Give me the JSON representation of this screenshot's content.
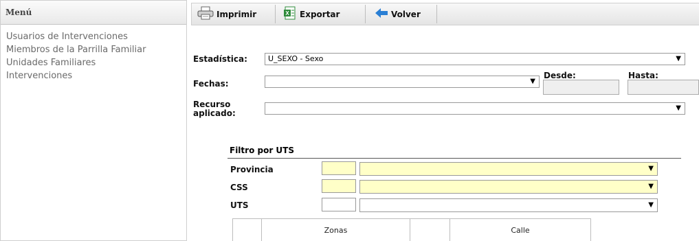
{
  "sidebar": {
    "title": "Menú",
    "items": [
      {
        "label": "Usuarios de Intervenciones"
      },
      {
        "label": "Miembros de la Parrilla Familiar"
      },
      {
        "label": "Unidades Familiares"
      },
      {
        "label": "Intervenciones"
      }
    ]
  },
  "toolbar": {
    "print_label": "Imprimir",
    "export_label": "Exportar",
    "back_label": "Volver"
  },
  "form": {
    "estadistica_label": "Estadística:",
    "estadistica_value": "U_SEXO - Sexo",
    "fechas_label": "Fechas:",
    "fechas_value": "",
    "desde_label": "Desde:",
    "hasta_label": "Hasta:",
    "recurso_label_line1": "Recurso",
    "recurso_label_line2": "aplicado:",
    "recurso_value": ""
  },
  "filter": {
    "title": "Filtro por UTS",
    "rows": [
      {
        "label": "Provincia",
        "code": "",
        "value": ""
      },
      {
        "label": "CSS",
        "code": "",
        "value": ""
      },
      {
        "label": "UTS",
        "code": "",
        "value": ""
      }
    ]
  },
  "tabs": [
    {
      "label": "Zonas"
    },
    {
      "label": "Calle"
    }
  ],
  "icons": {
    "dropdown": "▼"
  },
  "colors": {
    "required_field": "#ffffc8",
    "back_arrow": "#2a7fd4",
    "excel_green": "#2e8b3a"
  }
}
